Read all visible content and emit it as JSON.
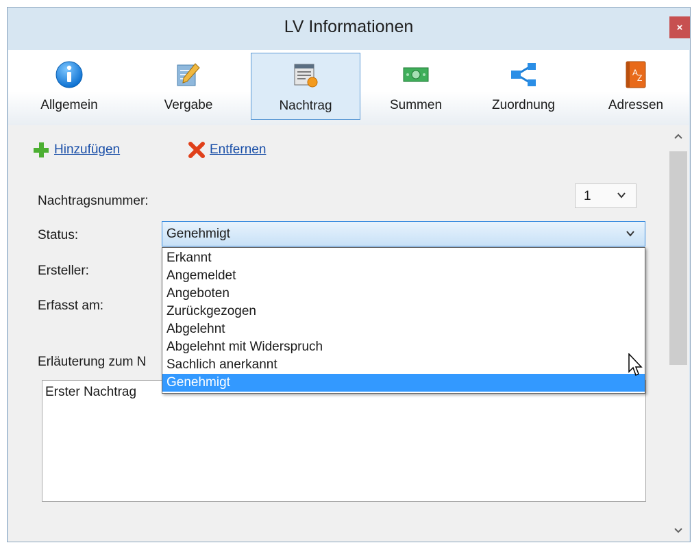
{
  "window": {
    "title": "LV Informationen",
    "close_glyph": "×"
  },
  "tabs": [
    {
      "label": "Allgemein",
      "icon": "info-icon",
      "active": false
    },
    {
      "label": "Vergabe",
      "icon": "notepad-pencil-icon",
      "active": false
    },
    {
      "label": "Nachtrag",
      "icon": "document-badge-icon",
      "active": true
    },
    {
      "label": "Summen",
      "icon": "money-icon",
      "active": false
    },
    {
      "label": "Zuordnung",
      "icon": "share-tree-icon",
      "active": false
    },
    {
      "label": "Adressen",
      "icon": "address-book-icon",
      "active": false
    }
  ],
  "actions": {
    "add_label": "Hinzufügen",
    "remove_label": "Entfernen"
  },
  "form": {
    "nachtragsnummer_label": "Nachtragsnummer:",
    "nachtragsnummer_value": "1",
    "status_label": "Status:",
    "status_value": "Genehmigt",
    "ersteller_label": "Ersteller:",
    "erfasst_label": "Erfasst am:",
    "erlaeuterung_label": "Erläuterung zum N",
    "notes_value": "Erster Nachtrag"
  },
  "status_options": [
    "Erkannt",
    "Angemeldet",
    "Angeboten",
    "Zurückgezogen",
    "Abgelehnt",
    "Abgelehnt mit Widerspruch",
    "Sachlich anerkannt",
    "Genehmigt"
  ],
  "selected_status_index": 7,
  "colors": {
    "window_bg": "#d7e6f2",
    "accent": "#3399ff",
    "link": "#1a4fa8",
    "close_bg": "#c75050"
  }
}
